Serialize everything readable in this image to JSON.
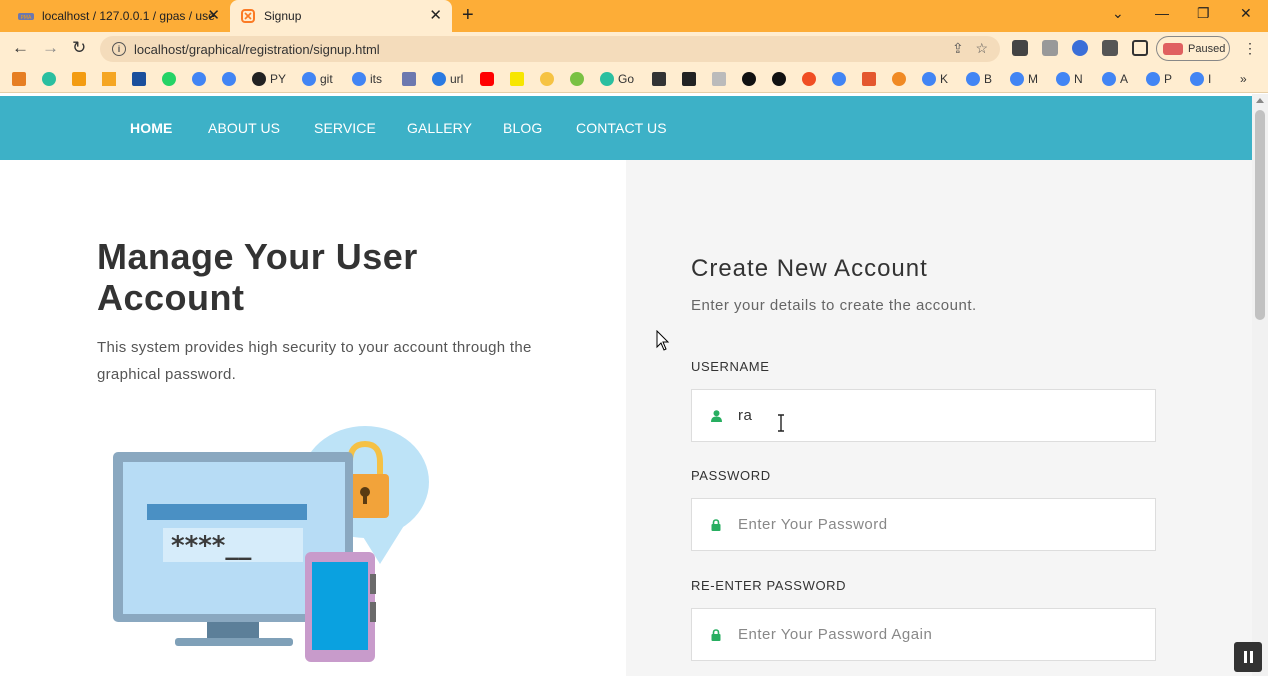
{
  "browser": {
    "tabs": [
      {
        "title": "localhost / 127.0.0.1 / gpas / use",
        "active": false
      },
      {
        "title": "Signup",
        "active": true
      }
    ],
    "address": "localhost/graphical/registration/signup.html",
    "profile_label": "Paused",
    "bookmarks": [
      "PY",
      "git",
      "its",
      "url",
      "Go",
      "K",
      "B",
      "M",
      "N",
      "A",
      "P",
      "I"
    ]
  },
  "nav": {
    "items": [
      "HOME",
      "ABOUT US",
      "SERVICE",
      "GALLERY",
      "BLOG",
      "CONTACT US"
    ]
  },
  "hero": {
    "title": "Manage Your User Account",
    "text": "This system provides high security to your account through the graphical password.",
    "illustration_text": "****__"
  },
  "form": {
    "title": "Create New Account",
    "subtitle": "Enter your details to create the account.",
    "username_label": "USERNAME",
    "username_value": "ra",
    "password_label": "PASSWORD",
    "password_placeholder": "Enter Your Password",
    "repassword_label": "RE-ENTER PASSWORD",
    "repassword_placeholder": "Enter Your Password Again"
  },
  "colors": {
    "tabstrip": "#fdad37",
    "toolbar": "#ffedd0",
    "navbar": "#3db1c7",
    "icon_green": "#27ae60"
  }
}
